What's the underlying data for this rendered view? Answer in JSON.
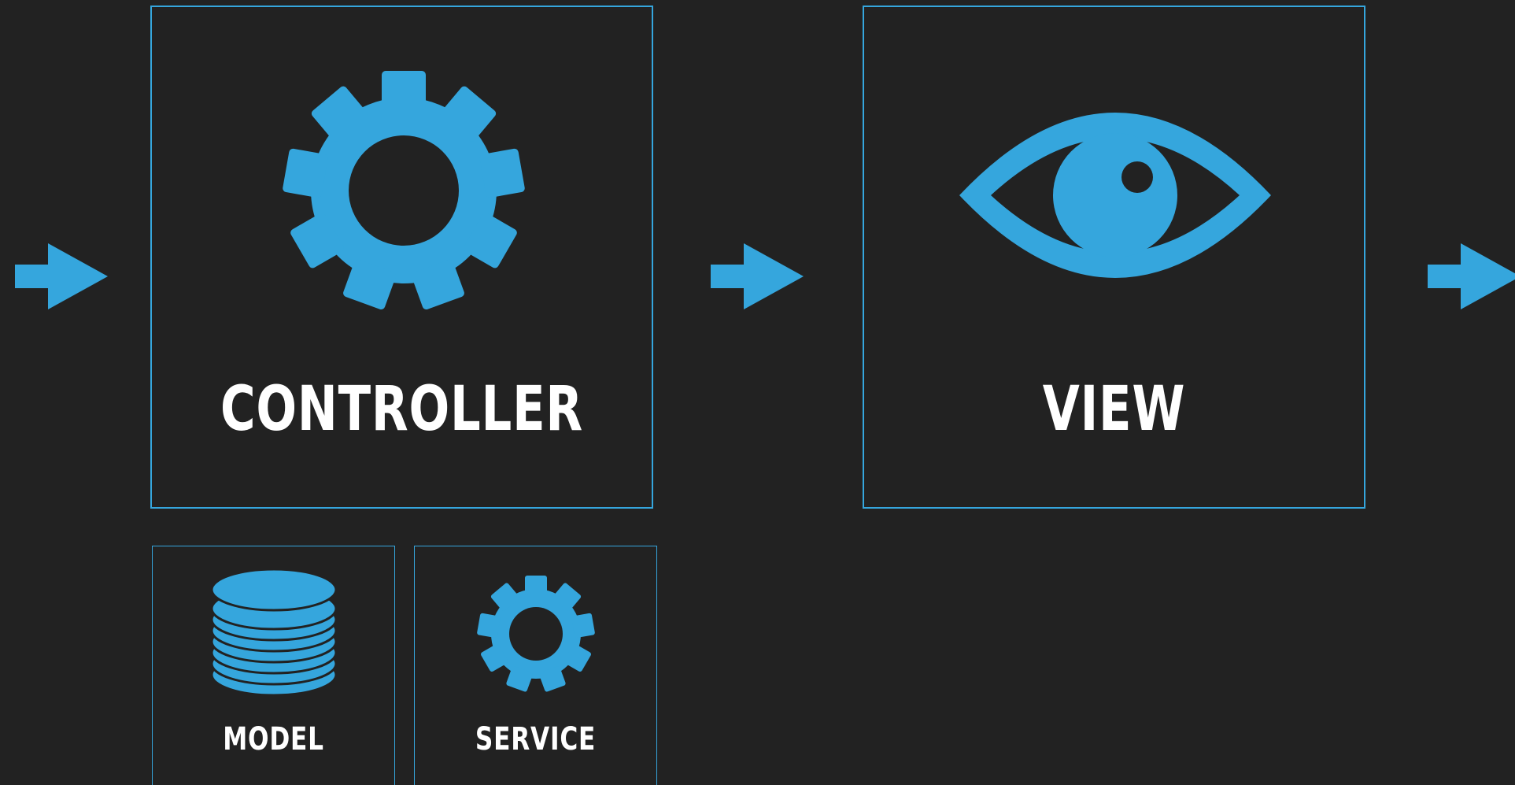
{
  "diagram": {
    "accent_color": "#35a6dd",
    "background_color": "#222222",
    "text_color": "#ffffff",
    "nodes": [
      {
        "id": "controller",
        "label": "CONTROLLER",
        "icon": "gear-icon"
      },
      {
        "id": "view",
        "label": "VIEW",
        "icon": "eye-icon"
      },
      {
        "id": "model",
        "label": "MODEL",
        "icon": "database-icon"
      },
      {
        "id": "service",
        "label": "SERVICE",
        "icon": "gear-icon"
      }
    ],
    "connectors": [
      {
        "from": "",
        "to": "controller",
        "icon": "arrow-right-icon"
      },
      {
        "from": "controller",
        "to": "view",
        "icon": "arrow-right-icon"
      },
      {
        "from": "view",
        "to": "",
        "icon": "arrow-right-icon"
      }
    ]
  }
}
